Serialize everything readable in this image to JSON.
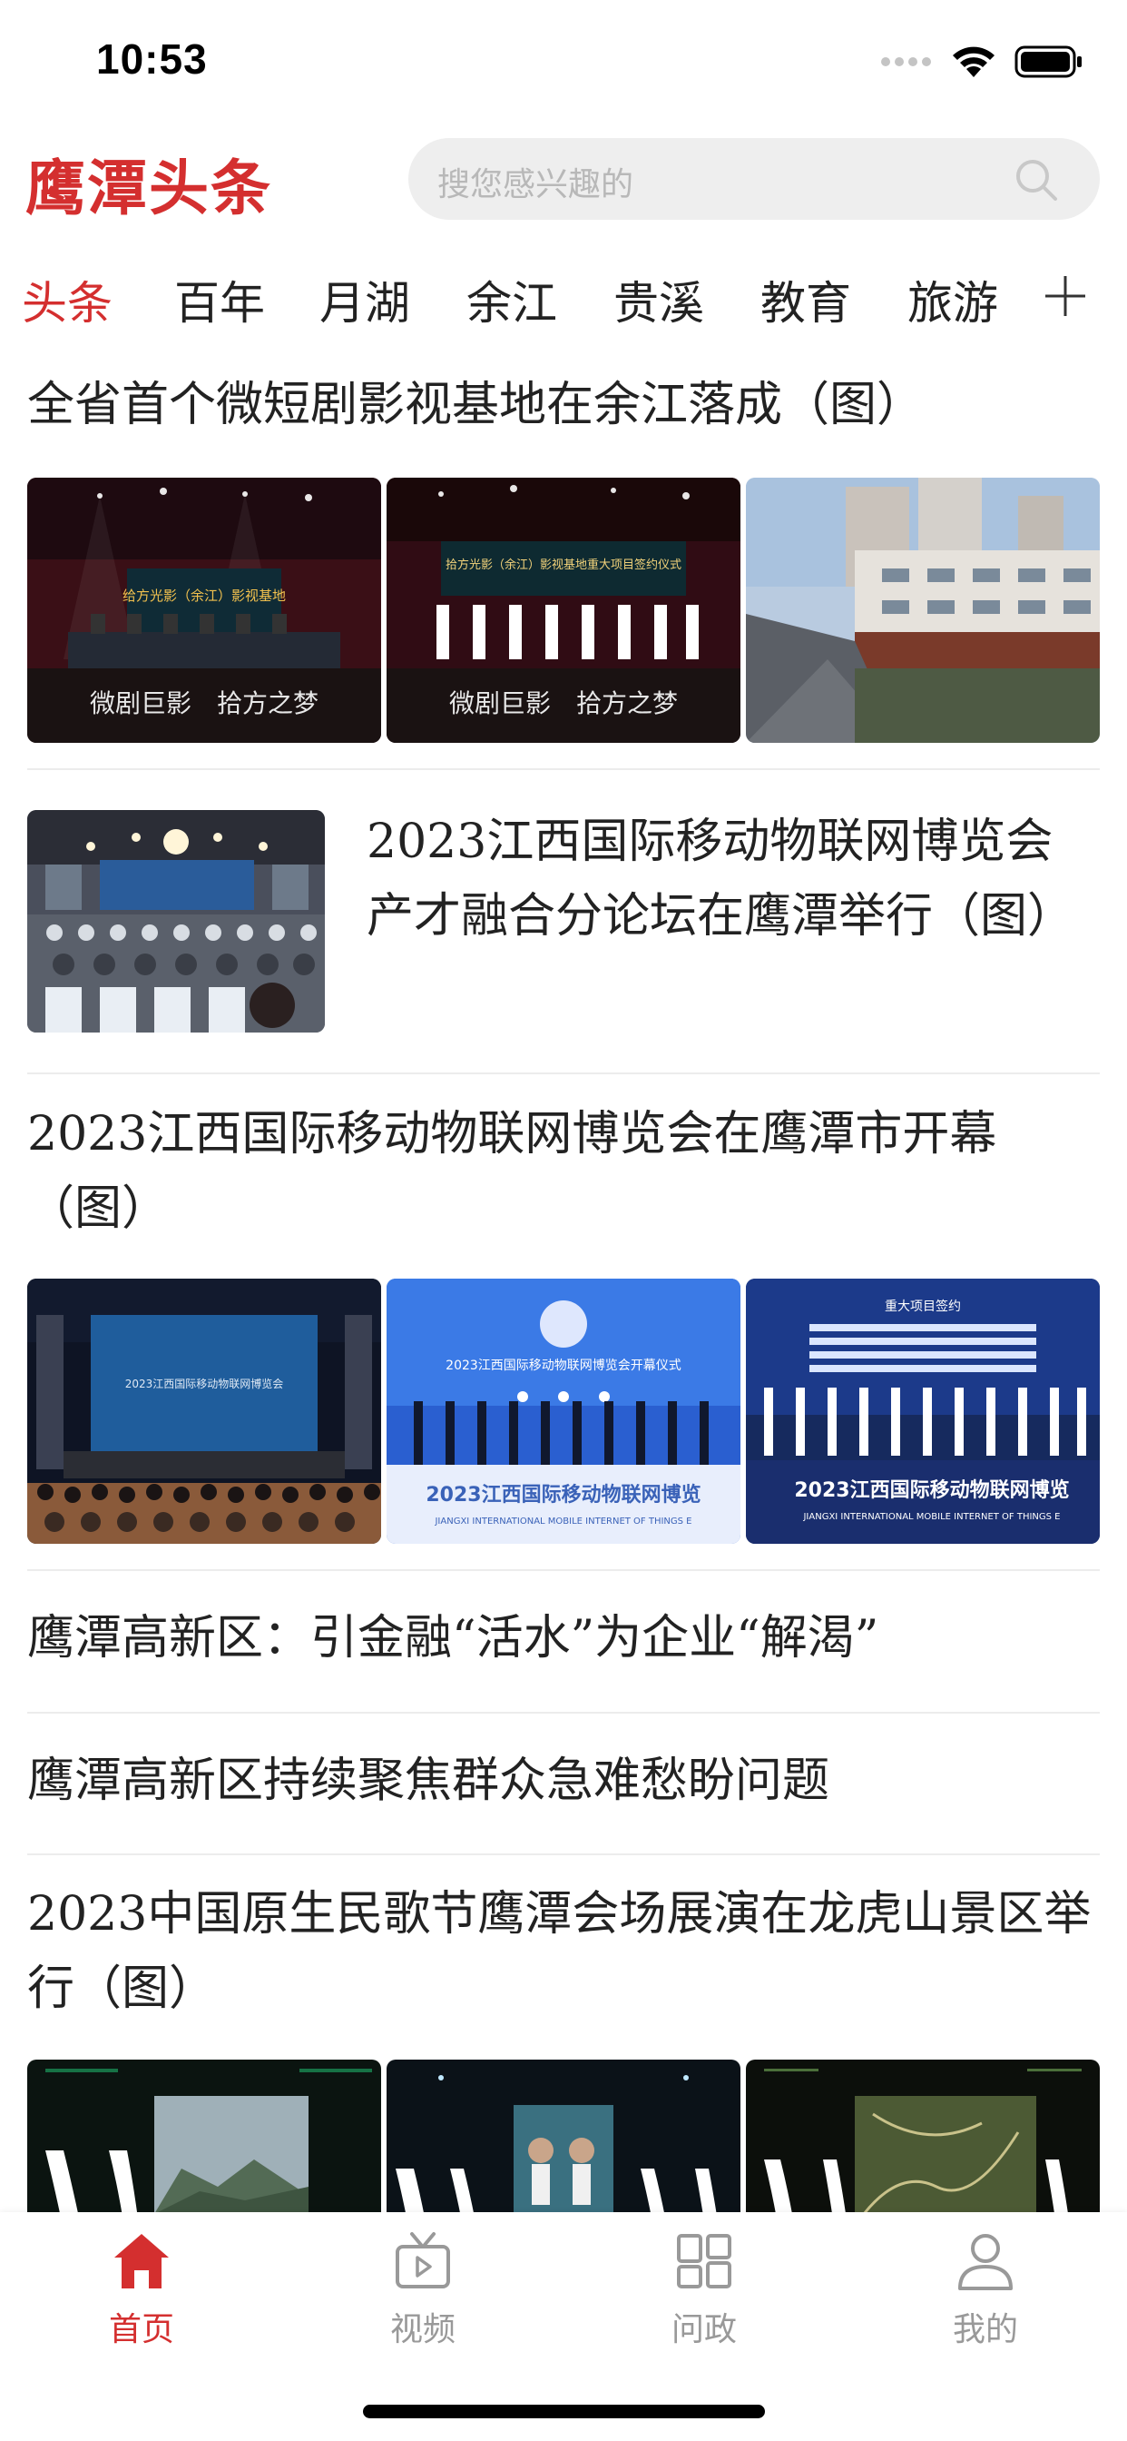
{
  "status_bar": {
    "time": "10:53"
  },
  "header": {
    "logo_text": "鹰潭头条",
    "search_placeholder": "搜您感兴趣的"
  },
  "channels": [
    "头条",
    "百年",
    "月湖",
    "余江",
    "贵溪",
    "教育",
    "旅游"
  ],
  "active_channel": "头条",
  "news": [
    {
      "title": "全省首个微短剧影视基地在余江落成（图）",
      "layout": "three-images"
    },
    {
      "title": "2023江西国际移动物联网博览会产才融合分论坛在鹰潭举行（图）",
      "layout": "single-image"
    },
    {
      "title": "2023江西国际移动物联网博览会在鹰潭市开幕（图）",
      "layout": "three-images"
    },
    {
      "title": "鹰潭高新区：引金融“活水”为企业“解渴”",
      "layout": "text"
    },
    {
      "title": "鹰潭高新区持续聚焦群众急难愁盼问题",
      "layout": "text"
    },
    {
      "title": "2023中国原生民歌节鹰潭会场展演在龙虎山景区举行（图）",
      "layout": "three-images"
    }
  ],
  "image_text": {
    "img1_banner": "给方光影（余江）影视基地",
    "img1_caption": "微剧巨影　拾方之梦",
    "img2_banner": "拾方光影（余江）影视基地重大项目签约仪式",
    "img2_caption": "微剧巨影　拾方之梦",
    "img4_screen": "2023江西国际移动物联网博览会",
    "img5_banner": "2023江西国际移动物联网博览会开幕仪式",
    "img5_floor": "2023江西国际移动物联网博览",
    "img5_floor_en": "JIANGXI INTERNATIONAL MOBILE INTERNET OF THINGS E",
    "img6_banner": "重大项目签约",
    "img6_floor": "2023江西国际移动物联网博览",
    "img6_floor_en": "JIANGXI INTERNATIONAL MOBILE INTERNET OF THINGS E"
  },
  "tabbar": [
    {
      "label": "首页",
      "icon": "home-icon",
      "active": true
    },
    {
      "label": "视频",
      "icon": "tv-icon",
      "active": false
    },
    {
      "label": "问政",
      "icon": "grid-icon",
      "active": false
    },
    {
      "label": "我的",
      "icon": "user-icon",
      "active": false
    }
  ],
  "colors": {
    "accent": "#d42f2f",
    "text": "#222222",
    "muted": "#999999",
    "divider": "#ececec"
  }
}
